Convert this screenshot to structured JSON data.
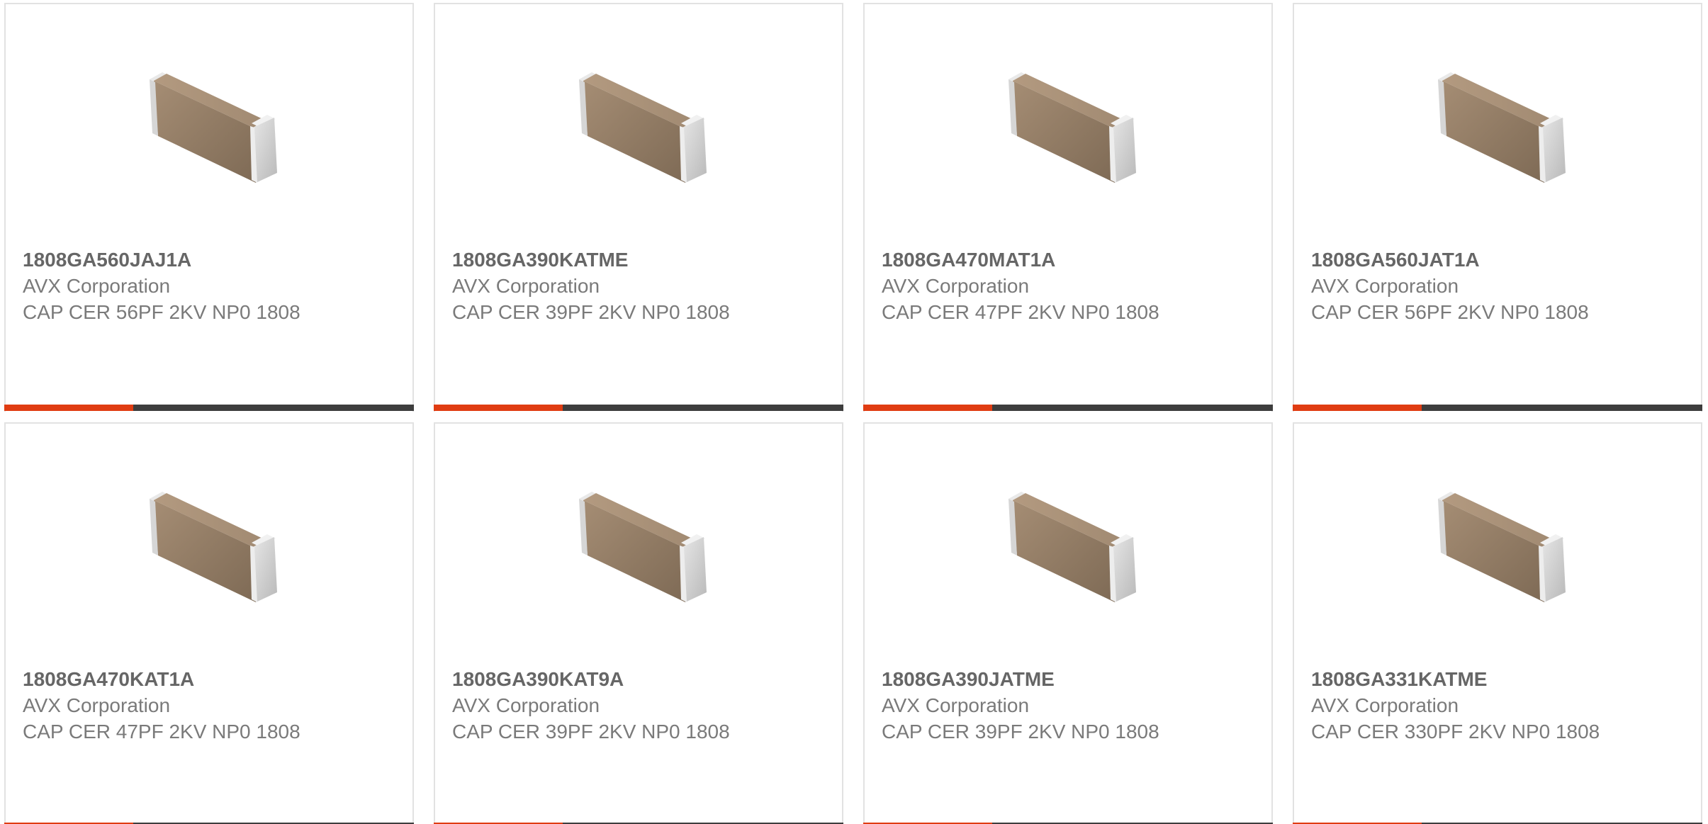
{
  "colors": {
    "accent": "#e03c12",
    "bar": "#3d3d3d",
    "border": "#e2e2e2",
    "text": "#7a7a7a",
    "title": "#666666"
  },
  "image_icon": "capacitor-chip-icon",
  "products": [
    {
      "part": "1808GA560JAJ1A",
      "manufacturer": "AVX Corporation",
      "description": "CAP CER 56PF 2KV NP0 1808"
    },
    {
      "part": "1808GA390KATME",
      "manufacturer": "AVX Corporation",
      "description": "CAP CER 39PF 2KV NP0 1808"
    },
    {
      "part": "1808GA470MAT1A",
      "manufacturer": "AVX Corporation",
      "description": "CAP CER 47PF 2KV NP0 1808"
    },
    {
      "part": "1808GA560JAT1A",
      "manufacturer": "AVX Corporation",
      "description": "CAP CER 56PF 2KV NP0 1808"
    },
    {
      "part": "1808GA470KAT1A",
      "manufacturer": "AVX Corporation",
      "description": "CAP CER 47PF 2KV NP0 1808"
    },
    {
      "part": "1808GA390KAT9A",
      "manufacturer": "AVX Corporation",
      "description": "CAP CER 39PF 2KV NP0 1808"
    },
    {
      "part": "1808GA390JATME",
      "manufacturer": "AVX Corporation",
      "description": "CAP CER 39PF 2KV NP0 1808"
    },
    {
      "part": "1808GA331KATME",
      "manufacturer": "AVX Corporation",
      "description": "CAP CER 330PF 2KV NP0 1808"
    }
  ]
}
